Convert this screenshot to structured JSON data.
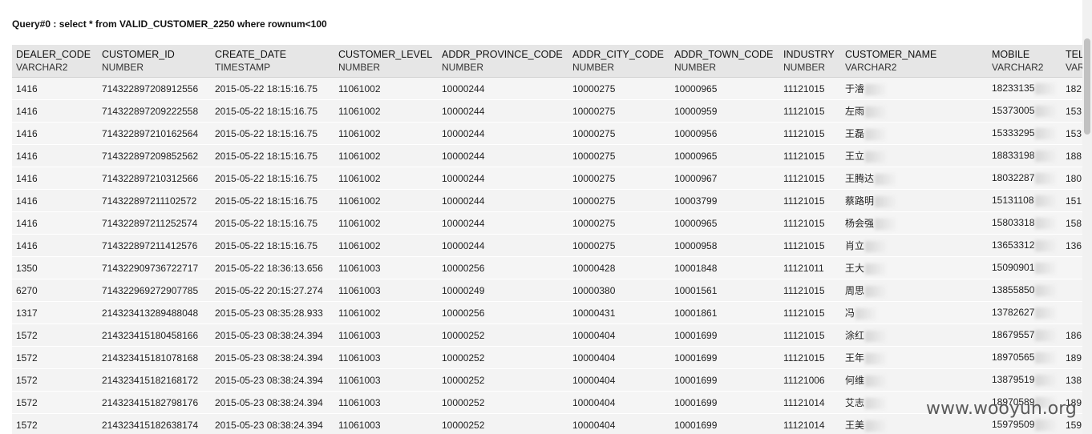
{
  "query": {
    "title": "Query#0 : select * from VALID_CUSTOMER_2250 where rownum<100"
  },
  "watermark": "www.wooyun.org",
  "columns": [
    {
      "name": "DEALER_CODE",
      "type": "VARCHAR2"
    },
    {
      "name": "CUSTOMER_ID",
      "type": "NUMBER"
    },
    {
      "name": "CREATE_DATE",
      "type": "TIMESTAMP"
    },
    {
      "name": "CUSTOMER_LEVEL",
      "type": "NUMBER"
    },
    {
      "name": "ADDR_PROVINCE_CODE",
      "type": "NUMBER"
    },
    {
      "name": "ADDR_CITY_CODE",
      "type": "NUMBER"
    },
    {
      "name": "ADDR_TOWN_CODE",
      "type": "NUMBER"
    },
    {
      "name": "INDUSTRY",
      "type": "NUMBER"
    },
    {
      "name": "CUSTOMER_NAME",
      "type": "VARCHAR2"
    },
    {
      "name": "MOBILE",
      "type": "VARCHAR2"
    },
    {
      "name": "TEL",
      "type": "VAR"
    }
  ],
  "rows": [
    [
      "1416",
      "714322897208912556",
      "2015-05-22 18:15:16.75",
      "11061002",
      "10000244",
      "10000275",
      "10000965",
      "11121015",
      "于濬",
      "18233135",
      "182"
    ],
    [
      "1416",
      "714322897209222558",
      "2015-05-22 18:15:16.75",
      "11061002",
      "10000244",
      "10000275",
      "10000959",
      "11121015",
      "左雨",
      "15373005",
      "153"
    ],
    [
      "1416",
      "714322897210162564",
      "2015-05-22 18:15:16.75",
      "11061002",
      "10000244",
      "10000275",
      "10000956",
      "11121015",
      "王磊",
      "15333295",
      "153"
    ],
    [
      "1416",
      "714322897209852562",
      "2015-05-22 18:15:16.75",
      "11061002",
      "10000244",
      "10000275",
      "10000965",
      "11121015",
      "王立",
      "18833198",
      "188"
    ],
    [
      "1416",
      "714322897210312566",
      "2015-05-22 18:15:16.75",
      "11061002",
      "10000244",
      "10000275",
      "10000967",
      "11121015",
      "王腾达",
      "18032287",
      "180"
    ],
    [
      "1416",
      "714322897211102572",
      "2015-05-22 18:15:16.75",
      "11061002",
      "10000244",
      "10000275",
      "10003799",
      "11121015",
      "蔡路明",
      "15131108",
      "151"
    ],
    [
      "1416",
      "714322897211252574",
      "2015-05-22 18:15:16.75",
      "11061002",
      "10000244",
      "10000275",
      "10000965",
      "11121015",
      "杨会强",
      "15803318",
      "158"
    ],
    [
      "1416",
      "714322897211412576",
      "2015-05-22 18:15:16.75",
      "11061002",
      "10000244",
      "10000275",
      "10000958",
      "11121015",
      "肖立",
      "13653312",
      "136"
    ],
    [
      "1350",
      "714322909736722717",
      "2015-05-22 18:36:13.656",
      "11061003",
      "10000256",
      "10000428",
      "10001848",
      "11121011",
      "王大",
      "15090901",
      ""
    ],
    [
      "6270",
      "714322969272907785",
      "2015-05-22 20:15:27.274",
      "11061003",
      "10000249",
      "10000380",
      "10001561",
      "11121015",
      "周思",
      "13855850",
      ""
    ],
    [
      "1317",
      "214323413289488048",
      "2015-05-23 08:35:28.933",
      "11061002",
      "10000256",
      "10000431",
      "10001861",
      "11121015",
      "冯",
      "13782627",
      ""
    ],
    [
      "1572",
      "214323415180458166",
      "2015-05-23 08:38:24.394",
      "11061003",
      "10000252",
      "10000404",
      "10001699",
      "11121015",
      "涂红",
      "18679557",
      "186"
    ],
    [
      "1572",
      "214323415181078168",
      "2015-05-23 08:38:24.394",
      "11061003",
      "10000252",
      "10000404",
      "10001699",
      "11121015",
      "王年",
      "18970565",
      "189"
    ],
    [
      "1572",
      "214323415182168172",
      "2015-05-23 08:38:24.394",
      "11061003",
      "10000252",
      "10000404",
      "10001699",
      "11121006",
      "何维",
      "13879519",
      "138"
    ],
    [
      "1572",
      "214323415182798176",
      "2015-05-23 08:38:24.394",
      "11061003",
      "10000252",
      "10000404",
      "10001699",
      "11121014",
      "艾志",
      "18970589",
      "189"
    ],
    [
      "1572",
      "214323415182638174",
      "2015-05-23 08:38:24.394",
      "11061003",
      "10000252",
      "10000404",
      "10001699",
      "11121014",
      "王美",
      "15979509",
      "159"
    ]
  ]
}
